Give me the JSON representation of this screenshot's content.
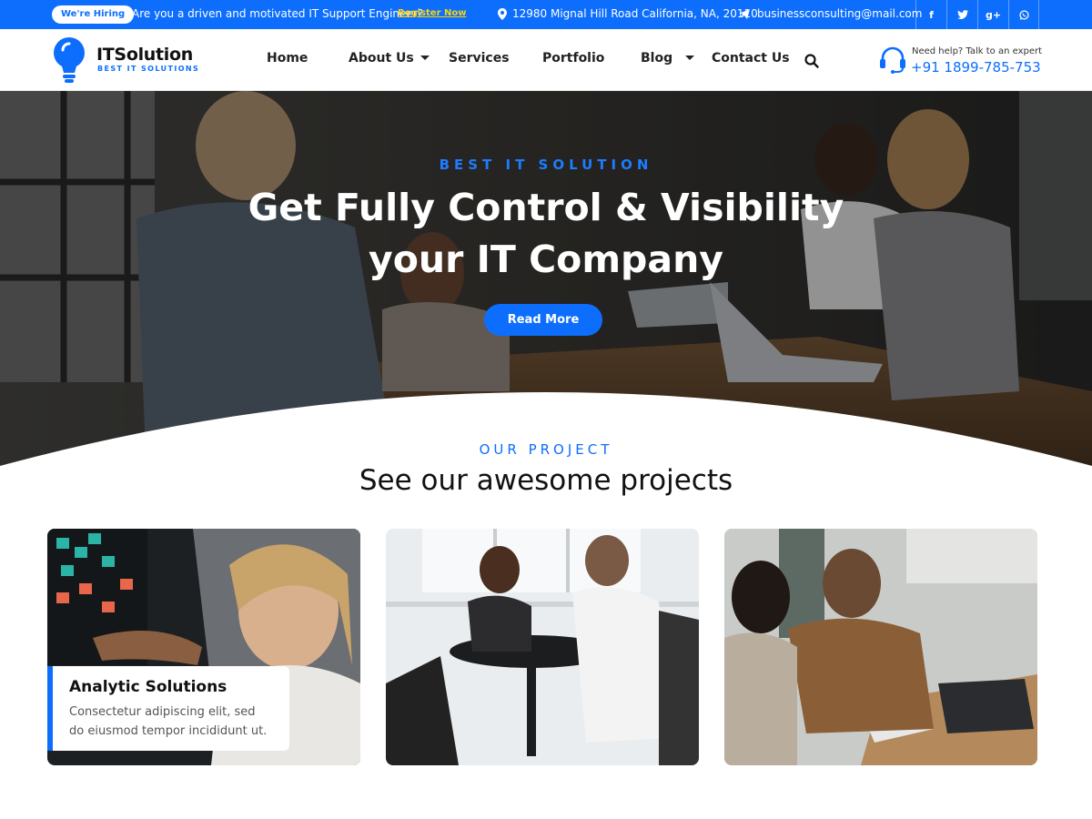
{
  "topbar": {
    "hiring_badge": "We're Hiring",
    "message": "Are you a driven and motivated  IT Support Engineer?",
    "register_label": "Register Now",
    "address": "12980 Mignal Hill Road California, NA, 20110",
    "email": "businessconsulting@mail.com",
    "socials": [
      {
        "label": "f",
        "icon": "facebook-icon"
      },
      {
        "label": "t",
        "icon": "twitter-icon"
      },
      {
        "label": "g+",
        "icon": "google-plus-icon"
      },
      {
        "label": "w",
        "icon": "whatsapp-icon"
      }
    ],
    "bg_color": "#0d6efd",
    "register_color": "#ffd400"
  },
  "header": {
    "logo_title": "ITSolution",
    "logo_tagline": "BEST IT SOLUTIONS",
    "nav": [
      {
        "label": "Home",
        "has_dropdown": false
      },
      {
        "label": "About Us",
        "has_dropdown": true
      },
      {
        "label": "Services",
        "has_dropdown": false
      },
      {
        "label": "Portfolio",
        "has_dropdown": false
      },
      {
        "label": "Blog",
        "has_dropdown": true
      },
      {
        "label": "Contact Us",
        "has_dropdown": false
      }
    ],
    "help_label": "Need help? Talk to an expert",
    "help_phone": "+91 1899-785-753"
  },
  "hero": {
    "kicker": "BEST IT SOLUTION",
    "title": "Get Fully Control & Visibility your IT Company",
    "button_label": "Read More"
  },
  "projects": {
    "kicker": "OUR PROJECT",
    "title": "See our awesome projects",
    "cards": [
      {
        "title": "Analytic Solutions",
        "text": "Consectetur adipiscing elit, sed do eiusmod tempor incididunt ut."
      },
      {},
      {}
    ]
  },
  "accent_color": "#0d6efd"
}
